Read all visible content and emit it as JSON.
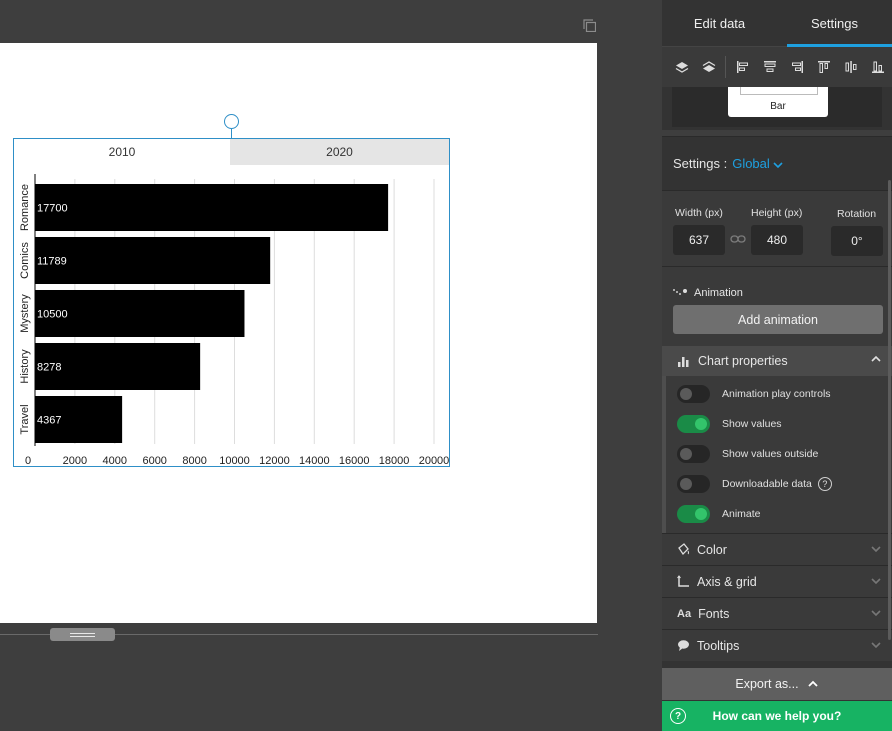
{
  "panel": {
    "tabs": [
      {
        "label": "Edit data"
      },
      {
        "label": "Settings"
      }
    ],
    "thumbnail_label": "Bar",
    "settings_label": "Settings :",
    "settings_scope": "Global",
    "dimensions": {
      "width_label": "Width (px)",
      "width_value": "637",
      "height_label": "Height (px)",
      "height_value": "480",
      "rotation_label": "Rotation",
      "rotation_value": "0°"
    },
    "animation_label": "Animation",
    "add_animation_label": "Add animation",
    "chart_properties_label": "Chart properties",
    "toggles": [
      {
        "label": "Animation play controls",
        "on": false
      },
      {
        "label": "Show values",
        "on": true
      },
      {
        "label": "Show values outside",
        "on": false
      },
      {
        "label": "Downloadable data",
        "on": false,
        "help": "?"
      },
      {
        "label": "Animate",
        "on": true
      }
    ],
    "accordions": [
      {
        "label": "Color",
        "icon": "paint-bucket-icon"
      },
      {
        "label": "Axis & grid",
        "icon": "axis-icon"
      },
      {
        "label": "Fonts",
        "icon": "font-icon",
        "glyph": "Aa"
      },
      {
        "label": "Tooltips",
        "icon": "speech-bubble-icon"
      }
    ],
    "export_label": "Export as...",
    "help_label": "How can we help you?",
    "help_glyph": "?"
  },
  "chart_tabs": [
    {
      "label": "2010"
    },
    {
      "label": "2020"
    }
  ],
  "colors": {
    "accent": "#1ea0e0",
    "bar": "#000000",
    "selection": "#2e8fc7",
    "help_green": "#17b363"
  },
  "chart_data": {
    "type": "bar",
    "orientation": "horizontal",
    "categories": [
      "Romance",
      "Comics",
      "Mystery",
      "History",
      "Travel"
    ],
    "values": [
      17700,
      11789,
      10500,
      8278,
      4367
    ],
    "xlim": [
      0,
      20000
    ],
    "xticks": [
      0,
      2000,
      4000,
      6000,
      8000,
      10000,
      12000,
      14000,
      16000,
      18000,
      20000
    ],
    "grid": true,
    "show_values": true
  }
}
